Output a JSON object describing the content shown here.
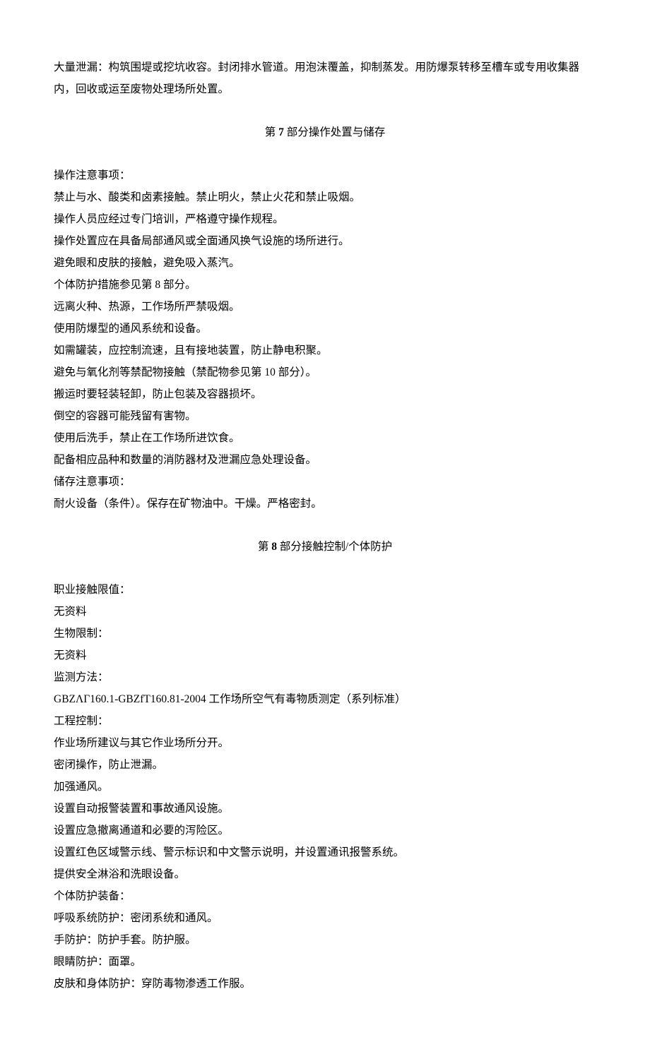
{
  "intro": {
    "p1": "大量泄漏：构筑围堤或挖坑收容。封闭排水管道。用泡沫覆盖，抑制蒸发。用防爆泵转移至槽车或专用收集器内，回收或运至废物处理场所处置。"
  },
  "section7": {
    "prefix": "第 ",
    "num": "7",
    "suffix": " 部分操作处置与储存",
    "lines": [
      "操作注意事项：",
      "禁止与水、酸类和卤素接触。禁止明火，禁止火花和禁止吸烟。",
      "操作人员应经过专门培训，严格遵守操作规程。",
      "操作处置应在具备局部通风或全面通风换气设施的场所进行。",
      "避免眼和皮肤的接触，避免吸入蒸汽。",
      "个体防护措施参见第 8 部分。",
      "远离火种、热源，工作场所严禁吸烟。",
      "使用防爆型的通风系统和设备。",
      "如需罐装，应控制流速，且有接地装置，防止静电积聚。",
      "避免与氧化剂等禁配物接触（禁配物参见第 10 部分）。",
      "搬运时要轻装轻卸，防止包装及容器损坏。",
      "倒空的容器可能残留有害物。",
      "使用后洗手，禁止在工作场所进饮食。",
      "配备相应品种和数量的消防器材及泄漏应急处理设备。",
      "储存注意事项：",
      "耐火设备（条件）。保存在矿物油中。干燥。严格密封。"
    ]
  },
  "section8": {
    "prefix": "第 ",
    "num": "8",
    "suffix": " 部分接触控制/个体防护",
    "lines": [
      "职业接触限值：",
      "无资料",
      "生物限制：",
      "无资料",
      "监测方法：",
      "GBZΛΓ160.1-GBZfT160.81-2004 工作场所空气有毒物质测定（系列标准）",
      "工程控制：",
      "作业场所建议与其它作业场所分开。",
      "密闭操作，防止泄漏。",
      "加强通风。",
      "设置自动报警装置和事故通风设施。",
      "设置应急撤离通道和必要的泻险区。",
      "设置红色区域警示线、警示标识和中文警示说明，并设置通讯报警系统。",
      "提供安全淋浴和洗眼设备。",
      "个体防护装备：",
      "呼吸系统防护：密闭系统和通风。",
      "手防护：防护手套。防护服。",
      "眼睛防护：面罩。",
      "皮肤和身体防护：穿防毒物渗透工作服。"
    ]
  }
}
